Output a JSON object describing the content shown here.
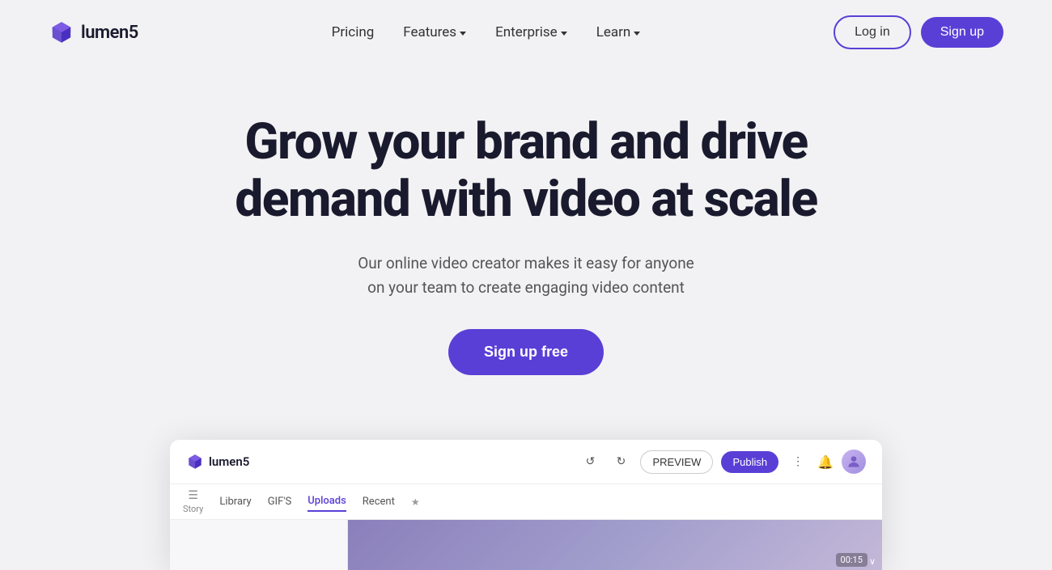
{
  "brand": {
    "name": "lumen5",
    "logo_alt": "Lumen5 logo"
  },
  "nav": {
    "pricing_label": "Pricing",
    "features_label": "Features",
    "enterprise_label": "Enterprise",
    "learn_label": "Learn",
    "login_label": "Log in",
    "signup_label": "Sign up"
  },
  "hero": {
    "title_line1": "Grow your brand and drive",
    "title_line2": "demand with video at scale",
    "subtitle_line1": "Our online video creator makes it easy for anyone",
    "subtitle_line2": "on your team to create engaging video content",
    "cta_label": "Sign up free"
  },
  "app_preview": {
    "logo_text": "lumen5",
    "preview_btn": "PREVIEW",
    "publish_btn": "Publish",
    "story_label": "Story",
    "library_label": "Library",
    "gifs_label": "GIF'S",
    "uploads_label": "Uploads",
    "recent_label": "Recent",
    "time": "00:15"
  },
  "colors": {
    "brand_purple": "#5a3fd6",
    "text_dark": "#1a1a2e",
    "text_mid": "#555555",
    "bg_light": "#f2f2f4"
  }
}
